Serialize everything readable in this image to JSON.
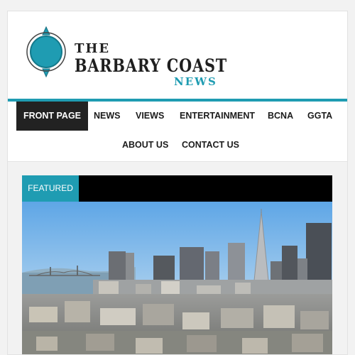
{
  "site": {
    "logo_the": "THE",
    "logo_main": "BARBARY COAST",
    "logo_news": "NEWS",
    "accent_color": "#1f9cb2"
  },
  "nav": {
    "row1": [
      "FRONT PAGE",
      "NEWS",
      "VIEWS",
      "ENTERTAINMENT",
      "BCNA",
      "GGTA"
    ],
    "row2": [
      "ABOUT US",
      "CONTACT US"
    ],
    "active": "FRONT PAGE"
  },
  "featured": {
    "label": "FEATURED",
    "image": "san-francisco-skyline-transamerica-pyramid"
  }
}
